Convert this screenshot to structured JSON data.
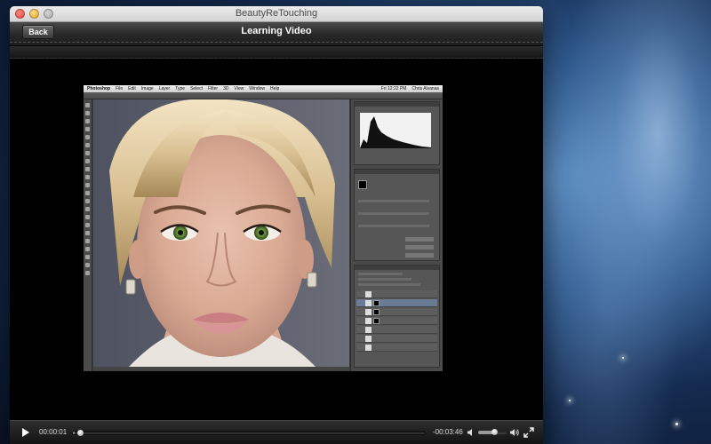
{
  "window": {
    "title": "BeautyReTouching"
  },
  "navbar": {
    "back_label": "Back",
    "title": "Learning Video"
  },
  "photoshop": {
    "app_name": "Photoshop",
    "menu": [
      "File",
      "Edit",
      "Image",
      "Layer",
      "Type",
      "Select",
      "Filter",
      "3D",
      "View",
      "Window",
      "Help"
    ],
    "clock": "Fri 12:22 PM",
    "user": "Chris Alvanas"
  },
  "player": {
    "current_time": "00:00:01",
    "remaining_time": "-00:03:46",
    "progress_fraction": 0.004,
    "volume_fraction": 0.55
  },
  "icons": {
    "play": "play-icon",
    "volume_low": "speaker-low-icon",
    "volume_high": "speaker-high-icon",
    "fullscreen": "fullscreen-icon"
  }
}
